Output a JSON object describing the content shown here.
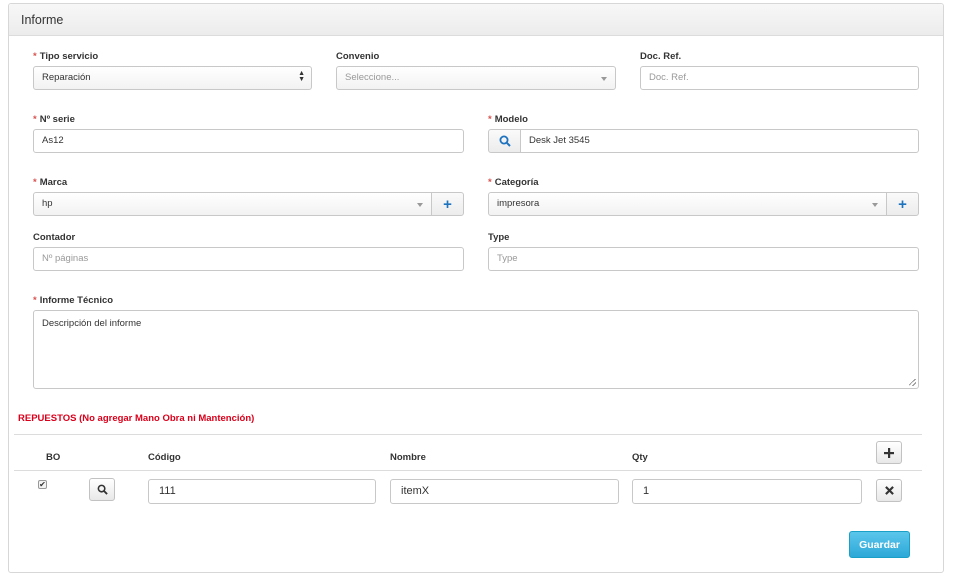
{
  "panel": {
    "title": "Informe"
  },
  "required_mark": "*",
  "form": {
    "tipo_servicio": {
      "label": "Tipo servicio",
      "value": "Reparación"
    },
    "convenio": {
      "label": "Convenio",
      "placeholder": "Seleccione..."
    },
    "doc_ref": {
      "label": "Doc. Ref.",
      "placeholder": "Doc. Ref."
    },
    "n_serie": {
      "label": "Nº serie",
      "value": "As12"
    },
    "modelo": {
      "label": "Modelo",
      "value": "Desk Jet 3545"
    },
    "marca": {
      "label": "Marca",
      "value": "hp"
    },
    "categoria": {
      "label": "Categoría",
      "value": "impresora"
    },
    "contador": {
      "label": "Contador",
      "placeholder": "Nº páginas"
    },
    "type": {
      "label": "Type",
      "placeholder": "Type"
    },
    "informe_tecnico": {
      "label": "Informe Técnico",
      "placeholder": "Descripción del informe"
    }
  },
  "repuestos": {
    "title": "REPUESTOS (No agregar Mano Obra ni Mantención)",
    "columns": {
      "bo": "BO",
      "codigo": "Código",
      "nombre": "Nombre",
      "qty": "Qty"
    },
    "rows": [
      {
        "bo_checked": true,
        "codigo": "111",
        "nombre": "itemX",
        "qty": "1"
      }
    ]
  },
  "actions": {
    "save": "Guardar"
  },
  "icons": {
    "search": "search-icon",
    "plus": "plus-icon",
    "remove": "times-icon",
    "check": "✔"
  },
  "colors": {
    "accent": "#2da8d8",
    "required": "#d9534f",
    "section_title": "#d9001b",
    "add_icon": "#1e73be"
  }
}
